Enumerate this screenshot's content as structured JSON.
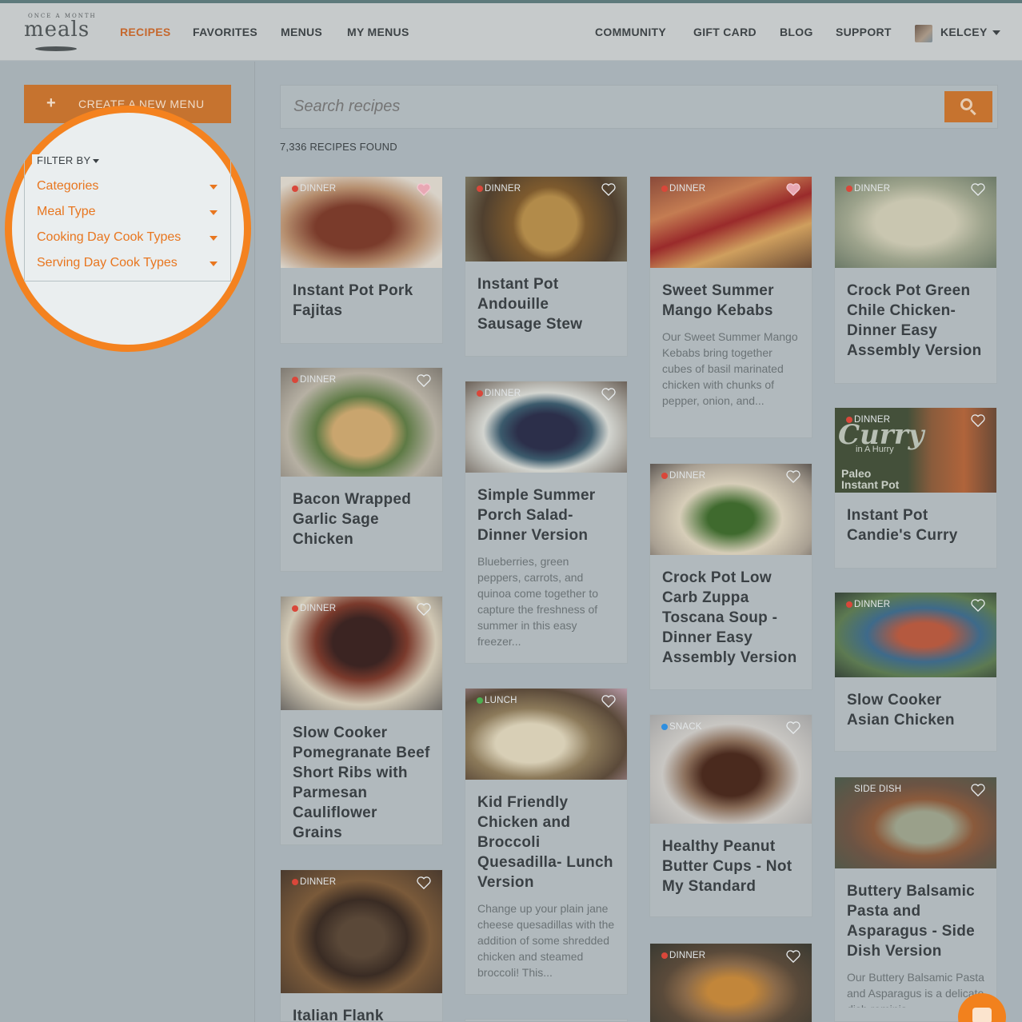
{
  "header": {
    "logo_small": "ONCE A MONTH",
    "logo_main": "meals",
    "nav_left": [
      "RECIPES",
      "FAVORITES",
      "MENUS",
      "MY MENUS"
    ],
    "nav_right": [
      "COMMUNITY",
      "GIFT CARD",
      "BLOG",
      "SUPPORT"
    ],
    "user": "KELCEY",
    "active_tab": "RECIPES"
  },
  "sidebar": {
    "create_button": "CREATE A NEW MENU",
    "create_icon": "+",
    "filter_title": "FILTER BY",
    "filters": [
      "Categories",
      "Meal Type",
      "Cooking Day Cook Types",
      "Serving Day Cook Types"
    ]
  },
  "search": {
    "placeholder": "Search recipes"
  },
  "results": {
    "count": "7,336 RECIPES FOUND"
  },
  "colors": {
    "accent": "#e8761f",
    "dinner": "#d9473a",
    "lunch": "#4caf50",
    "snack": "#2f8fe0"
  },
  "cards": [
    {
      "meal": "DINNER",
      "title": "Instant Pot Pork Fajitas",
      "desc": "",
      "favorited": true
    },
    {
      "meal": "DINNER",
      "title": "Instant Pot Andouille Sausage Stew",
      "desc": "",
      "favorited": false
    },
    {
      "meal": "DINNER",
      "title": "Sweet Summer Mango Kebabs",
      "desc": "Our Sweet Summer Mango Kebabs bring together cubes of basil marinated chicken with chunks of pepper, onion, and...",
      "favorited": true
    },
    {
      "meal": "DINNER",
      "title": "Crock Pot Green Chile Chicken- Dinner Easy Assembly Version",
      "desc": "",
      "favorited": false
    },
    {
      "meal": "DINNER",
      "title": "Bacon Wrapped Garlic Sage Chicken",
      "desc": "",
      "favorited": false
    },
    {
      "meal": "DINNER",
      "title": "Simple Summer Porch Salad- Dinner Version",
      "desc": "Blueberries, green peppers, carrots, and quinoa come together to capture the freshness of summer in this easy freezer...",
      "favorited": false
    },
    {
      "meal": "DINNER",
      "title": "Crock Pot Low Carb Zuppa Toscana Soup - Dinner Easy Assembly Version",
      "desc": "",
      "favorited": false
    },
    {
      "meal": "DINNER",
      "title": "Instant Pot Candie's Curry",
      "desc": "",
      "favorited": false,
      "img_text": [
        "Curry",
        "in A Hurry",
        "Paleo",
        "Instant Pot"
      ]
    },
    {
      "meal": "DINNER",
      "title": "Slow Cooker Pomegranate Beef Short Ribs with Parmesan Cauliflower Grains",
      "desc": "",
      "favorited": false
    },
    {
      "meal": "LUNCH",
      "title": "Kid Friendly Chicken and Broccoli Quesadilla- Lunch Version",
      "desc": "Change up your plain jane cheese quesadillas with the addition of some shredded chicken and steamed broccoli! This...",
      "favorited": false
    },
    {
      "meal": "DINNER",
      "title": "Slow Cooker Asian Chicken",
      "desc": "",
      "favorited": false
    },
    {
      "meal": "SNACK",
      "title": "Healthy Peanut Butter Cups - Not My Standard",
      "desc": "",
      "favorited": false
    },
    {
      "meal": "SIDE DISH",
      "title": "Buttery Balsamic Pasta and Asparagus - Side Dish Version",
      "desc": "Our Buttery Balsamic Pasta and Asparagus is a delicate dish reminis...",
      "favorited": false
    },
    {
      "meal": "DINNER",
      "title": "Italian Flank",
      "desc": "",
      "favorited": false
    },
    {
      "meal": "DINNER",
      "title": "",
      "desc": "",
      "favorited": false
    }
  ]
}
